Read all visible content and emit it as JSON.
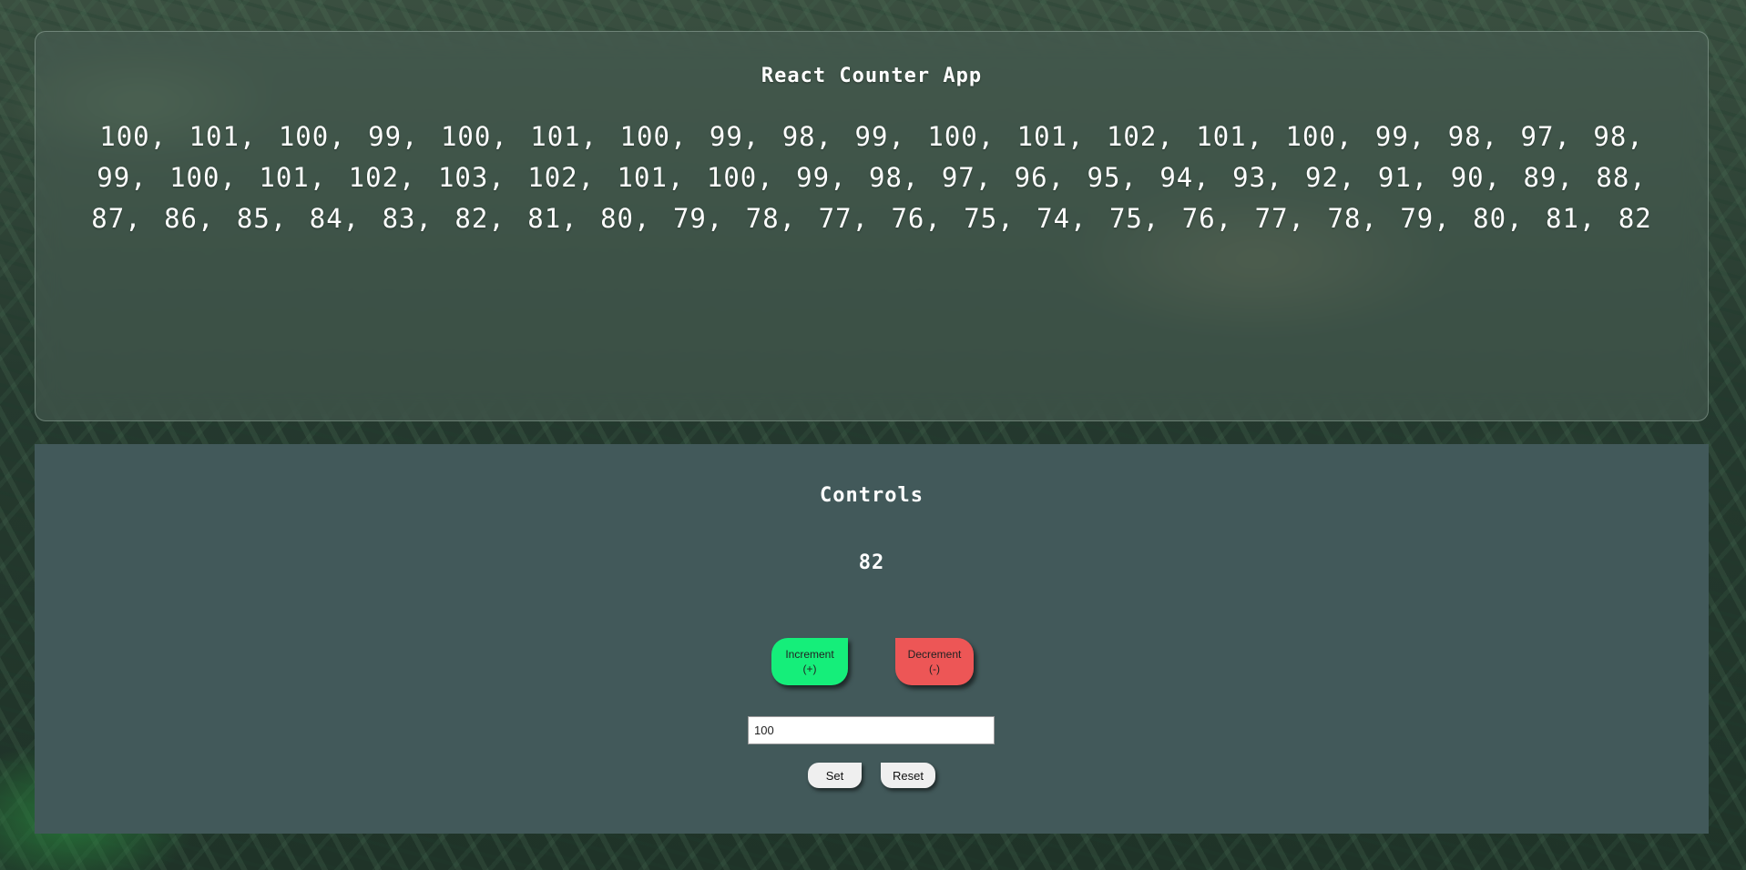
{
  "app": {
    "title": "React Counter App",
    "history": "100, 101, 100, 99, 100, 101, 100, 99, 98, 99, 100, 101, 102, 101, 100, 99, 98, 97, 98, 99, 100, 101, 102, 103, 102, 101, 100, 99, 98, 97, 96, 95, 94, 93, 92, 91, 90, 89, 88, 87, 86, 85, 84, 83, 82, 81, 80, 79, 78, 77, 76, 75, 74, 75, 76, 77, 78, 79, 80, 81, 82"
  },
  "controls": {
    "title": "Controls",
    "count": "82",
    "increment_label": "Increment\n(+)",
    "decrement_label": "Decrement\n(-)",
    "input_value": "100",
    "set_label": "Set",
    "reset_label": "Reset"
  },
  "colors": {
    "increment": "#15ee7a",
    "decrement": "#ed5656",
    "controls_background": "#42595a"
  }
}
